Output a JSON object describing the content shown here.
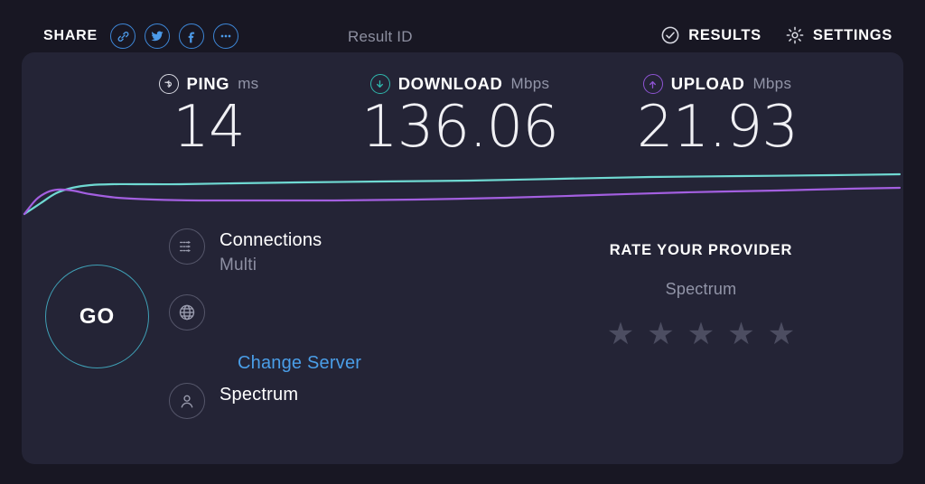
{
  "topbar": {
    "share_label": "SHARE",
    "share_icons": [
      {
        "name": "link-icon",
        "glyph": "link"
      },
      {
        "name": "twitter-icon",
        "glyph": "twitter"
      },
      {
        "name": "facebook-icon",
        "glyph": "facebook"
      },
      {
        "name": "more-options-icon",
        "glyph": "ellipsis"
      }
    ],
    "result_id": "Result ID",
    "results_label": "RESULTS",
    "settings_label": "SETTINGS",
    "results_icon": "check-circle-icon",
    "settings_icon": "gear-icon"
  },
  "metrics": {
    "ping": {
      "name": "PING",
      "unit": "ms",
      "value": "14",
      "icon": "ping-icon",
      "color": "#d8d9e2"
    },
    "download": {
      "name": "DOWNLOAD",
      "unit": "Mbps",
      "value": "136.06",
      "icon": "download-icon",
      "color": "#2fb8ad"
    },
    "upload": {
      "name": "UPLOAD",
      "unit": "Mbps",
      "value": "21.93",
      "icon": "upload-icon",
      "color": "#8e54d4"
    }
  },
  "chart_data": {
    "type": "line",
    "title": "",
    "xlabel": "",
    "ylabel": "",
    "grid": false,
    "legend": "none",
    "series": [
      {
        "name": "Download",
        "color": "#6fd9d2",
        "points": [
          [
            27,
            237
          ],
          [
            45,
            225
          ],
          [
            62,
            214
          ],
          [
            80,
            208
          ],
          [
            100,
            205
          ],
          [
            125,
            204
          ],
          [
            150,
            204
          ],
          [
            200,
            204
          ],
          [
            260,
            203
          ],
          [
            330,
            202
          ],
          [
            420,
            201
          ],
          [
            520,
            200
          ],
          [
            620,
            198
          ],
          [
            720,
            196
          ],
          [
            820,
            195
          ],
          [
            920,
            194
          ],
          [
            996,
            193
          ]
        ]
      },
      {
        "name": "Upload",
        "color": "#a35fe0",
        "points": [
          [
            27,
            237
          ],
          [
            40,
            221
          ],
          [
            52,
            213
          ],
          [
            64,
            210
          ],
          [
            80,
            211
          ],
          [
            100,
            215
          ],
          [
            130,
            219
          ],
          [
            170,
            221
          ],
          [
            220,
            222
          ],
          [
            290,
            222
          ],
          [
            370,
            222
          ],
          [
            460,
            221
          ],
          [
            560,
            219
          ],
          [
            660,
            216
          ],
          [
            760,
            213
          ],
          [
            860,
            211
          ],
          [
            940,
            209
          ],
          [
            996,
            208
          ]
        ]
      }
    ]
  },
  "controls": {
    "go_label": "GO",
    "connections": {
      "icon": "connections-icon",
      "title": "Connections",
      "value": "Multi"
    },
    "server": {
      "icon": "globe-icon",
      "change_server_label": "Change Server"
    },
    "provider": {
      "icon": "user-icon",
      "name": "Spectrum"
    }
  },
  "rate_provider": {
    "title": "RATE YOUR PROVIDER",
    "isp": "Spectrum",
    "stars": [
      "★",
      "★",
      "★",
      "★",
      "★"
    ],
    "rating": 0,
    "max_rating": 5
  },
  "colors": {
    "page_background": "#181723",
    "panel_background": "#242436",
    "download_accent": "#2fb8ad",
    "upload_accent": "#8e54d4",
    "link_blue": "#4a9ee8",
    "go_ring": "#3f9fb5",
    "star_empty": "#4c4d61"
  }
}
